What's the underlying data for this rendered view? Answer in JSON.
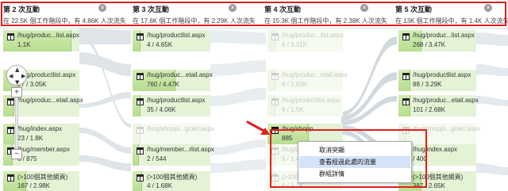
{
  "steps": [
    {
      "title": "第 2 次互動",
      "subtitle": "在 22.5K 個工作階段中，有 4.86K 人次流失"
    },
    {
      "title": "第 3 次互動",
      "subtitle": "在 17.6K 個工作階段中，有 2.29K 人次流失"
    },
    {
      "title": "第 4 次互動",
      "subtitle": "在 15.3K 個工作階段中，有 2.38K 人次流失"
    },
    {
      "title": "第 5 次互動",
      "subtitle": "在 13K 個工作階段中，有 1.4K 人次流失"
    }
  ],
  "close_glyph": "✕",
  "zoom": {
    "plus": "+",
    "minus": "−",
    "up": "▲",
    "down": "▼",
    "left": "◀",
    "right": "▶"
  },
  "columns": [
    {
      "nodes": [
        {
          "label": "/hug/produc...list.aspx",
          "stat": "1.1K",
          "fill": 0.9,
          "faded": false
        },
        {
          "label": "/hug/productlist.aspx",
          "stat": "17 / 3.05K",
          "fill": 0.2,
          "faded": false
        },
        {
          "label": "/hug/produc...etail.aspx",
          "stat": "",
          "fill": 0.15,
          "faded": false
        },
        {
          "label": "/hug/index.aspx",
          "stat": "23 / 1.8K",
          "fill": 0.15,
          "faded": false
        },
        {
          "label": "/hug/member.aspx",
          "stat": "6 / 875",
          "fill": 0.12,
          "faded": false
        },
        {
          "label": "(>100個其他網頁)",
          "stat": "167 / 2.98K",
          "fill": 0.3,
          "faded": false
        }
      ]
    },
    {
      "nodes": [
        {
          "label": "/hug/productlist.aspx",
          "stat": "4 / 4.65K",
          "fill": 0.1,
          "faded": false
        },
        {
          "label": "/hug/produc...etail.aspx",
          "stat": "760 / 4.47K",
          "fill": 0.55,
          "faded": false
        },
        {
          "label": "/hug/productlist.aspx",
          "stat": "35 / 4.06K",
          "fill": 0.1,
          "faded": false
        },
        {
          "label": "/hug/shoppi...gcart.aspx",
          "stat": "",
          "fill": 0.1,
          "faded": true
        },
        {
          "label": "/hug/member...rlist.aspx",
          "stat": "2 / 544",
          "fill": 0.08,
          "faded": false
        },
        {
          "label": "(>100個其他網頁)",
          "stat": "4 / 1.68K",
          "fill": 0.12,
          "faded": false
        }
      ]
    },
    {
      "nodes": [
        {
          "label": "/hug/produc...list.aspx",
          "stat": "6 / 3.31K",
          "fill": 0.1,
          "faded": true
        },
        {
          "label": "/hug/produc...etail.aspx",
          "stat": "6 / 2.62K",
          "fill": 0.1,
          "faded": true
        },
        {
          "label": "/hug/productlist.aspx",
          "stat": "6 / 1.5K",
          "fill": 0.1,
          "faded": true
        },
        {
          "label": "/hug/shopp...",
          "stat": "885",
          "fill": 0.55,
          "faded": false
        },
        {
          "label": "/hug/index.aspx",
          "stat": "5 / 1.4K",
          "fill": 0.1,
          "faded": true
        },
        {
          "label": "(>100個其他網頁)",
          "stat": "6 / 1.2K",
          "fill": 0.1,
          "faded": true
        }
      ]
    },
    {
      "nodes": [
        {
          "label": "/hug/produc...list.aspx",
          "stat": "268 / 3.47K",
          "fill": 0.3,
          "faded": false
        },
        {
          "label": "/hug/productlist.aspx",
          "stat": "88 / 3.29K",
          "fill": 0.15,
          "faded": false
        },
        {
          "label": "/hug/produc...etail.aspx",
          "stat": "101 / 2.68K",
          "fill": 0.15,
          "faded": false
        },
        {
          "label": "/hug/shoppi...gcart.aspx",
          "stat": "",
          "fill": 0.1,
          "faded": true
        },
        {
          "label": "/hug/index.aspx",
          "stat": "/ 400",
          "fill": 0.1,
          "faded": false
        },
        {
          "label": "(>100個其他網頁)",
          "stat": "387 / 2.65K",
          "fill": 0.3,
          "faded": false
        }
      ]
    }
  ],
  "context_menu": {
    "items": [
      "取消突顯",
      "查看經過此處的流量",
      "群組詳情"
    ],
    "hovered_index": 1
  },
  "colors": {
    "highlight": "#e0201c",
    "node_fill": "#b8dd90",
    "flow": "#cfd8dc",
    "menu_hover": "#d4e3f7"
  }
}
